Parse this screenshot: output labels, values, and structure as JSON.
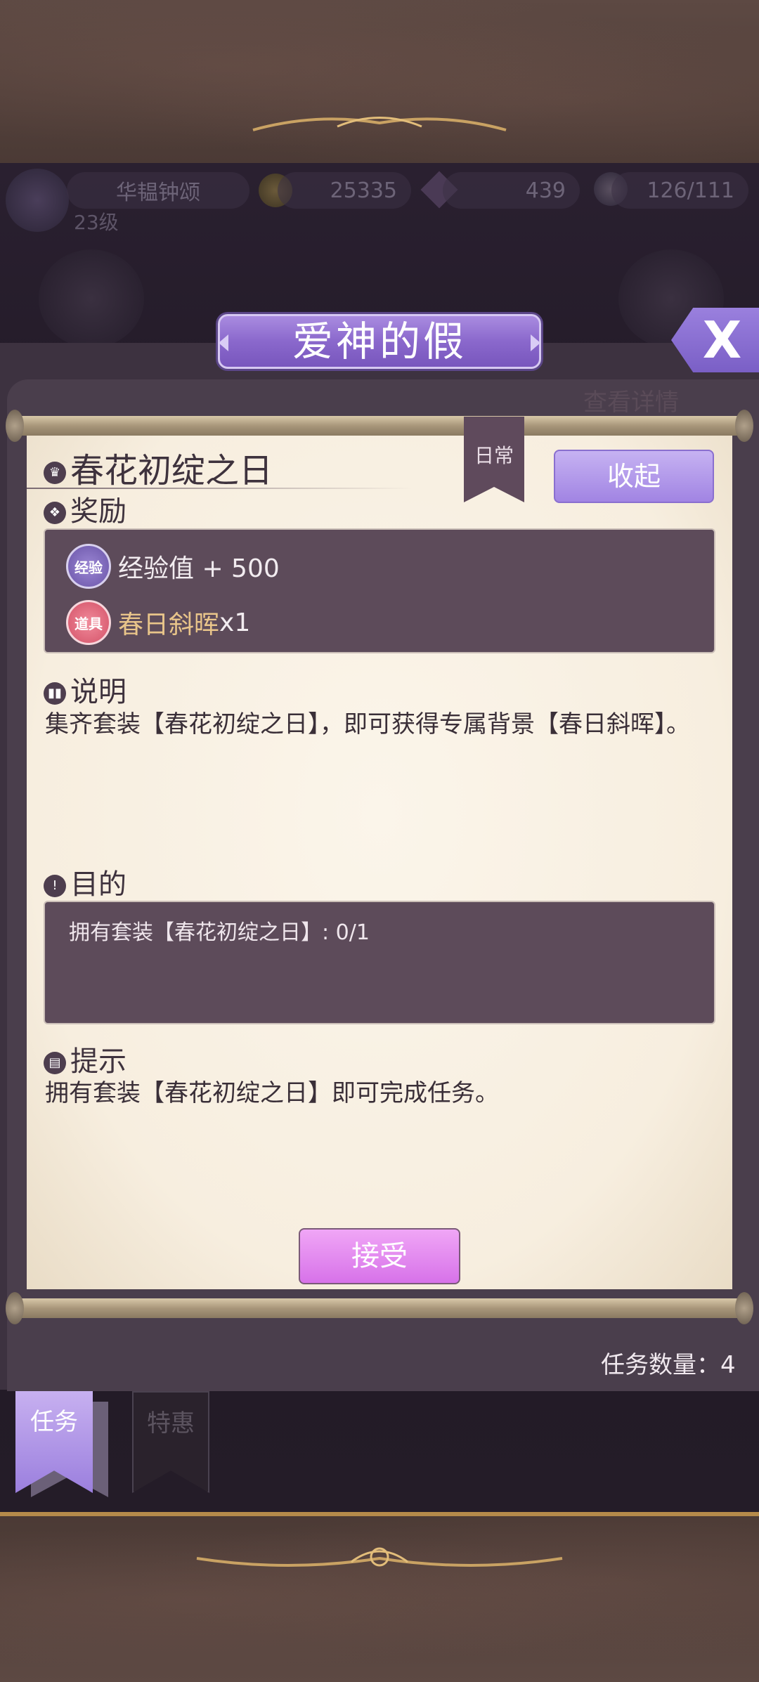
{
  "hud": {
    "player_name": "华韫钟颂",
    "level": "23级",
    "gold": "25335",
    "gems": "439",
    "energy": "126/111"
  },
  "dialog": {
    "title": "爱神的假",
    "close_label": "X",
    "background_label": "查看详情"
  },
  "task": {
    "tag": "日常",
    "name": "春花初绽之日",
    "collapse_label": "收起",
    "reward_heading": "奖励",
    "rewards": [
      {
        "badge": "经验",
        "text": "经验值 + 500"
      },
      {
        "badge": "道具",
        "item_name": "春日斜晖",
        "qty": "x1"
      }
    ],
    "desc_heading": "说明",
    "description": "集齐套装【春花初绽之日】，即可获得专属背景【春日斜晖】。",
    "goal_heading": "目的",
    "goal": "拥有套装【春花初绽之日】: 0/1",
    "hint_heading": "提示",
    "hint": "拥有套装【春花初绽之日】即可完成任务。",
    "accept_label": "接受"
  },
  "footer": {
    "task_count": "任务数量：4"
  },
  "tabs": [
    {
      "label": "任务",
      "active": true
    },
    {
      "label": "特惠",
      "active": false
    }
  ],
  "colors": {
    "accent": "#8a68cc",
    "paper": "#f7eedf",
    "panel": "#5d4b5a",
    "item_name": "#e9c58a"
  }
}
